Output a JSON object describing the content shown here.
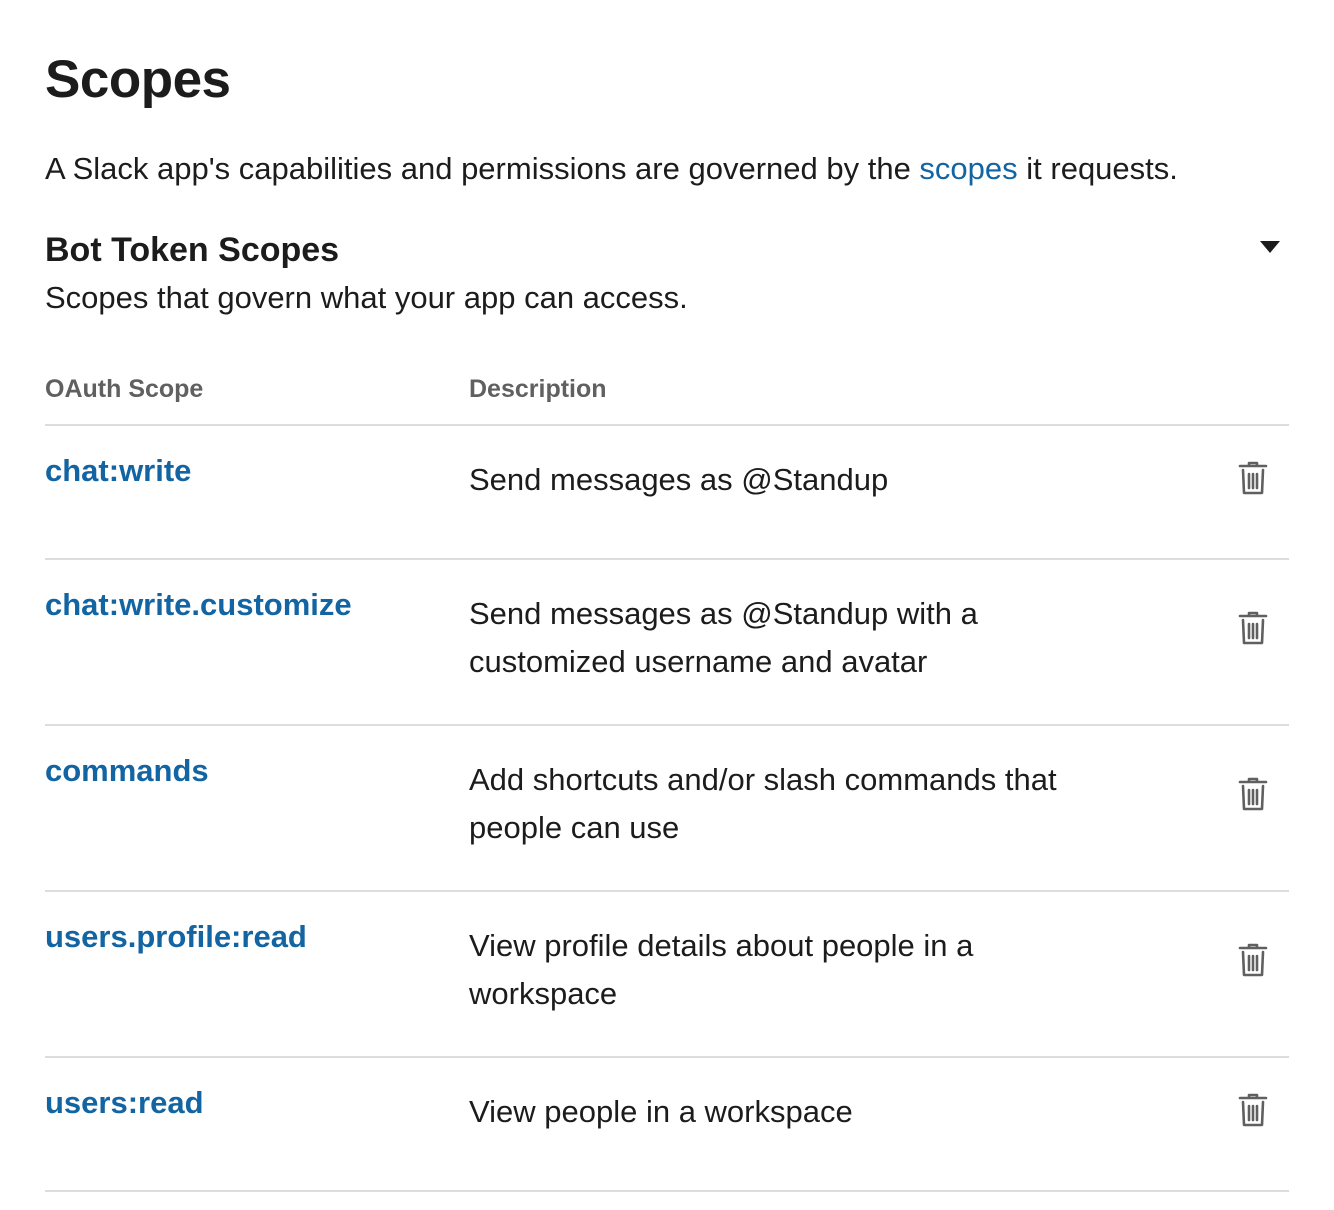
{
  "page": {
    "title": "Scopes",
    "intro_before": "A Slack app's capabilities and permissions are governed by the ",
    "intro_link": "scopes",
    "intro_after": " it requests."
  },
  "bot_section": {
    "title": "Bot Token Scopes",
    "subtitle": "Scopes that govern what your app can access.",
    "toggle_icon": "caret-down-icon"
  },
  "table": {
    "headers": {
      "scope": "OAuth Scope",
      "description": "Description"
    },
    "delete_icon": "trash-icon",
    "rows": [
      {
        "scope": "chat:write",
        "description": "Send messages as @Standup"
      },
      {
        "scope": "chat:write.customize",
        "description": "Send messages as @Standup with a customized username and avatar"
      },
      {
        "scope": "commands",
        "description": "Add shortcuts and/or slash commands that people can use"
      },
      {
        "scope": "users.profile:read",
        "description": "View profile details about people in a workspace"
      },
      {
        "scope": "users:read",
        "description": "View people in a workspace"
      }
    ]
  },
  "colors": {
    "link": "#1264a3",
    "text": "#1d1c1d",
    "muted": "#616061",
    "divider": "#dddddd",
    "icon": "#616061"
  }
}
